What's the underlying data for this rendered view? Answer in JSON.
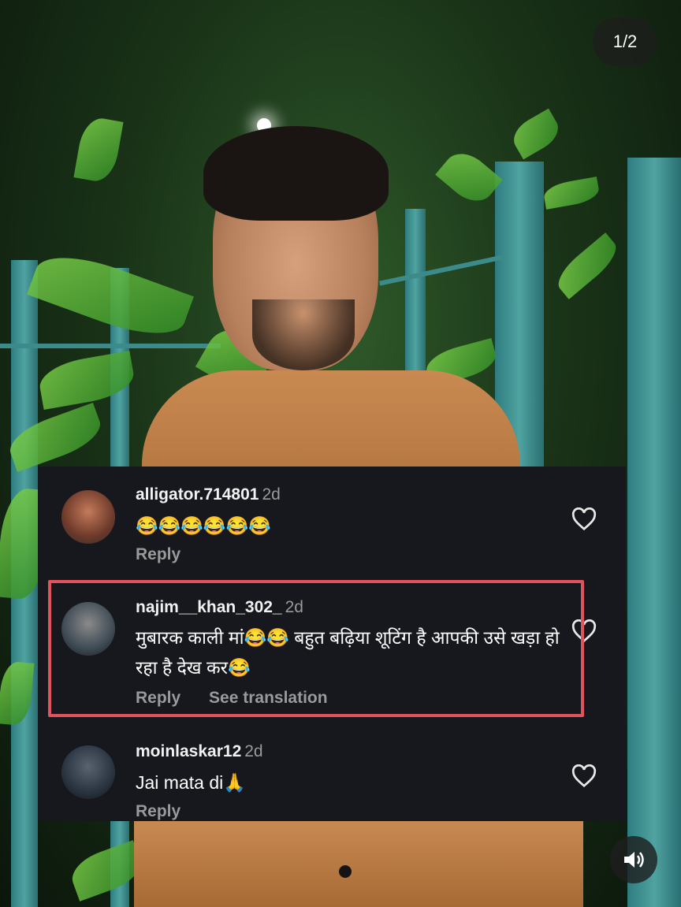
{
  "media": {
    "counter": "1/2"
  },
  "comments": [
    {
      "username": "alligator.714801",
      "time": "2d",
      "text": "😂😂😂😂😂😂",
      "reply_label": "Reply"
    },
    {
      "username": "najim__khan_302_",
      "time": "2d",
      "text": "मुबारक काली मां😂😂 बहुत बढ़िया शूटिंग है आपकी उसे खड़ा हो रहा है देख कर😂",
      "reply_label": "Reply",
      "translate_label": "See translation"
    },
    {
      "username": "moinlaskar12",
      "time": "2d",
      "text": "Jai mata di🙏",
      "reply_label": "Reply"
    }
  ],
  "colors": {
    "panel_bg": "#16181d",
    "highlight": "#e0535c",
    "muted_text": "#9a9a9a"
  },
  "icons": [
    "heart-icon",
    "sound-icon"
  ]
}
